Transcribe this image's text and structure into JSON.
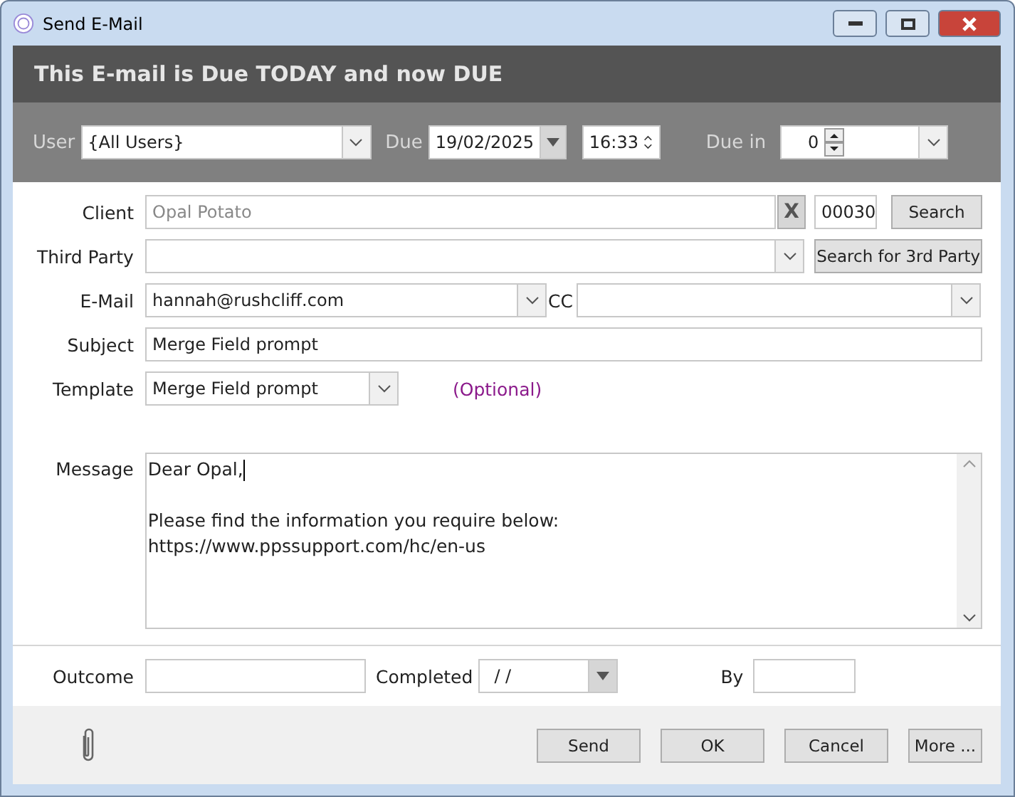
{
  "window": {
    "title": "Send E-Mail"
  },
  "banner": "This E-mail is Due TODAY and now DUE",
  "toolbar": {
    "user_label": "User",
    "user": "{All Users}",
    "due_label": "Due",
    "due_date": "19/02/2025",
    "due_time": "16:33",
    "due_in_label": "Due in",
    "due_in": "0"
  },
  "client": {
    "label": "Client",
    "value": "Opal Potato",
    "disabled": true,
    "clear": "X",
    "code": "00030",
    "button": "Search"
  },
  "third_party": {
    "label": "Third Party",
    "button": "Search for 3rd Party"
  },
  "email": {
    "label": "E-Mail",
    "value": "hannah@rushcliff.com",
    "cc_label": "CC"
  },
  "subject": {
    "label": "Subject",
    "value": "Merge Field prompt"
  },
  "template": {
    "label": "Template",
    "value": "Merge Field prompt",
    "note": "(Optional)"
  },
  "message": {
    "label": "Message",
    "paragraphs": [
      [
        "Dear Opal,"
      ],
      [
        "Please find the information you require below:",
        "https://www.ppssupport.com/hc/en-us"
      ]
    ]
  },
  "outcome": {
    "label": "Outcome",
    "completed_label": "Completed",
    "completed": "/  /",
    "by_label": "By"
  },
  "buttons": [
    "Send",
    "OK",
    "Cancel",
    "More ..."
  ]
}
